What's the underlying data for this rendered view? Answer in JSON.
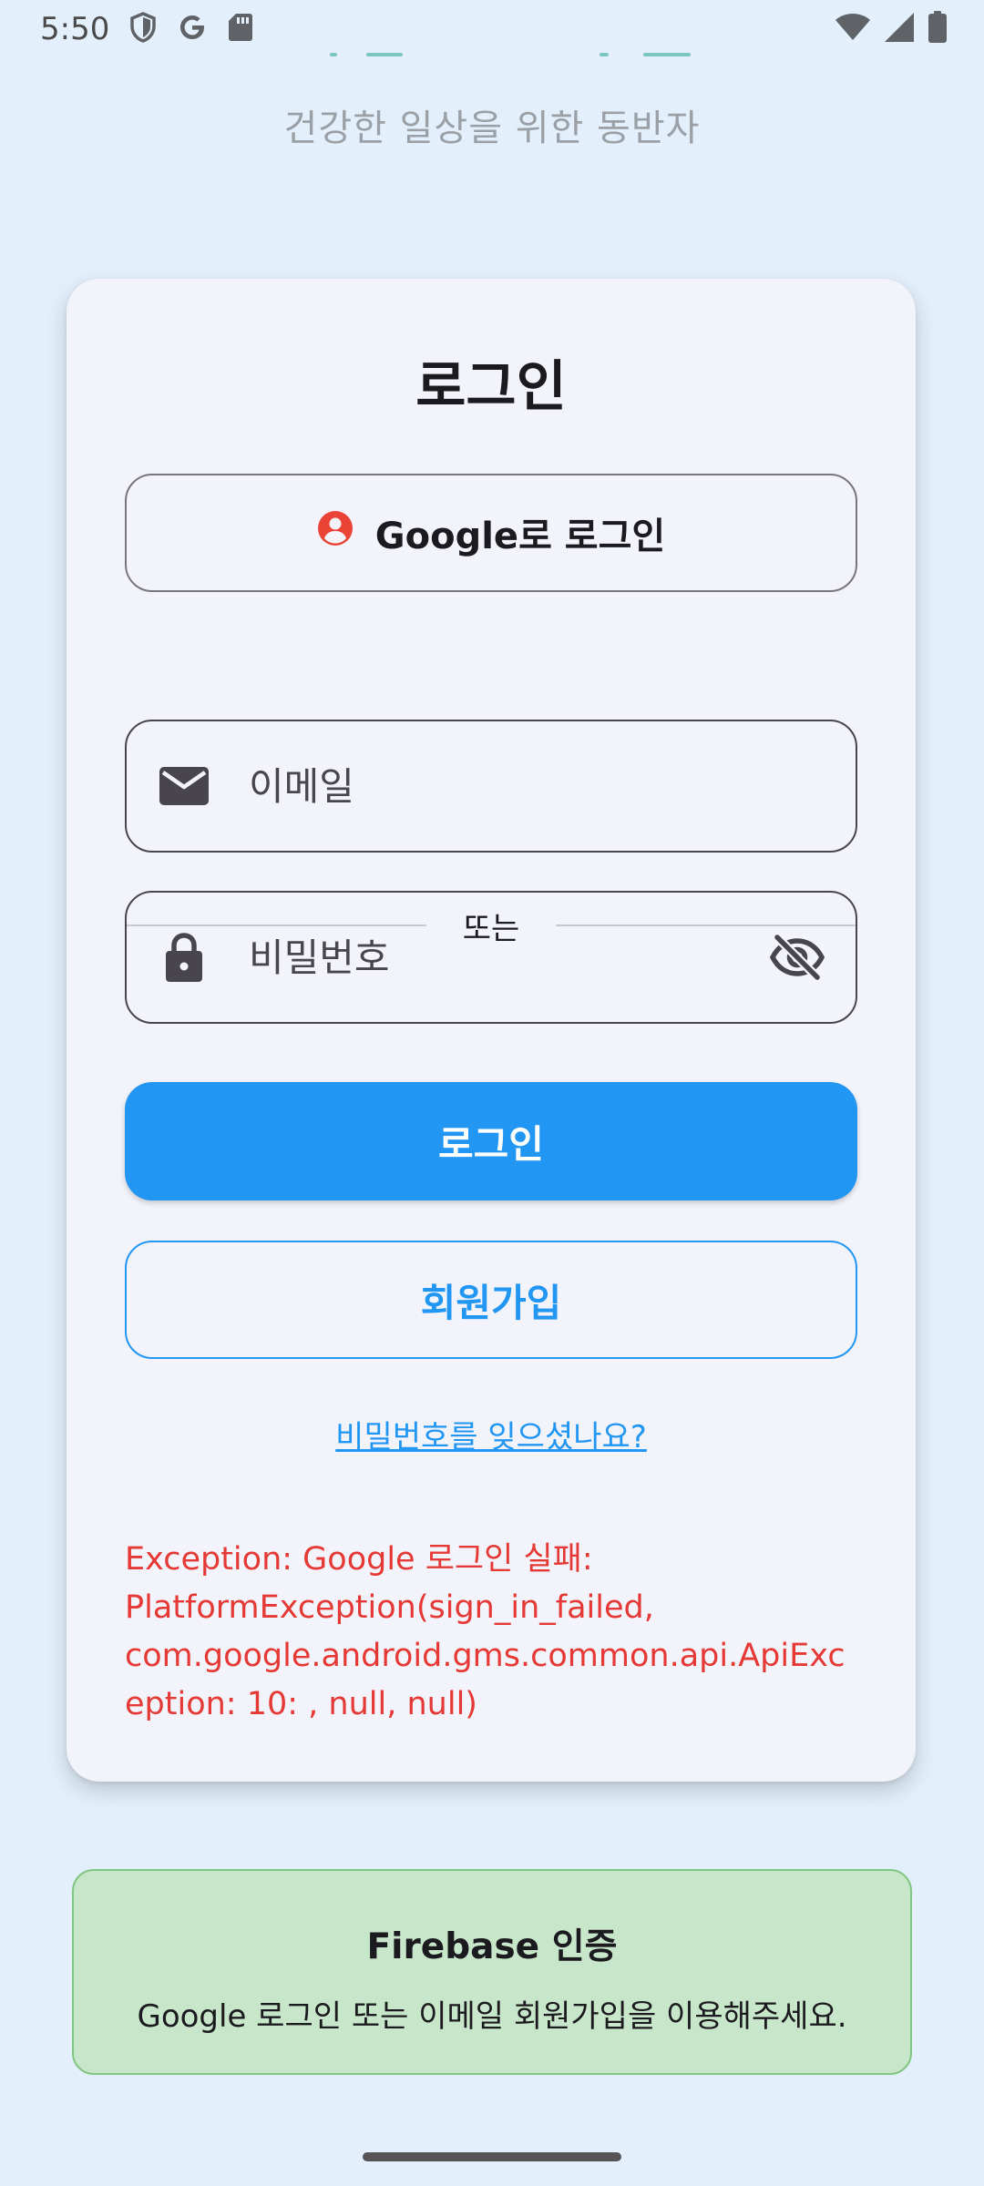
{
  "status_bar": {
    "time": "5:50",
    "icons": [
      "shield-icon",
      "google-g-icon",
      "sd-card-icon",
      "wifi-icon",
      "cellular-signal-icon",
      "battery-icon"
    ]
  },
  "header": {
    "subtitle": "건강한 일상을 위한 동반자"
  },
  "login_card": {
    "title": "로그인",
    "google_button_label": "Google로 로그인",
    "divider_label": "또는",
    "email_field": {
      "placeholder": "이메일",
      "value": "",
      "icon": "mail-icon"
    },
    "password_field": {
      "placeholder": "비밀번호",
      "value": "",
      "icon": "lock-icon",
      "toggle_icon": "visibility-off-icon"
    },
    "login_button_label": "로그인",
    "signup_button_label": "회원가입",
    "forgot_password_link": "비밀번호를 잊으셨나요?",
    "error_message": "Exception: Google 로그인 실패: PlatformException(sign_in_failed, com.google.android.gms.common.api.ApiException: 10: , null, null)"
  },
  "info_box": {
    "title": "Firebase 인증",
    "text": "Google 로그인 또는 이메일 회원가입을 이용해주세요."
  },
  "colors": {
    "background": "#e3f0fb",
    "card": "#f3f3fb",
    "primary": "#2196f3",
    "error": "#e53935",
    "info_bg": "#c8e6c9",
    "info_border": "#81c784",
    "google_icon": "#ea4335"
  }
}
